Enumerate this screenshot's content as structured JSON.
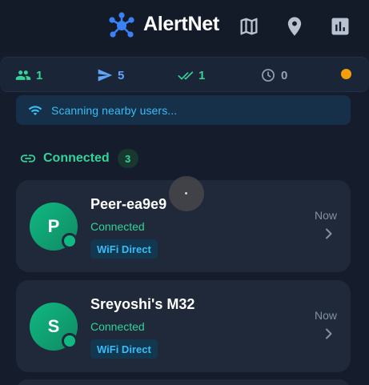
{
  "header": {
    "title": "AlertNet",
    "logo_icon": "network-hub-icon",
    "actions": [
      {
        "icon": "map-icon"
      },
      {
        "icon": "location-pin-icon"
      },
      {
        "icon": "bar-chart-icon"
      }
    ]
  },
  "stats": {
    "peers": {
      "icon": "people-icon",
      "value": "1",
      "color": "#34d399"
    },
    "sent": {
      "icon": "send-icon",
      "value": "5",
      "color": "#60a5fa"
    },
    "delivered": {
      "icon": "double-check-icon",
      "value": "1",
      "color": "#34d399"
    },
    "pending": {
      "icon": "clock-icon",
      "value": "0",
      "color": "#94a3b8"
    },
    "status_dot_color": "#f59e0b"
  },
  "scan": {
    "icon": "wifi-icon",
    "text": "Scanning nearby users..."
  },
  "section": {
    "icon": "link-icon",
    "title": "Connected",
    "count": "3"
  },
  "peers": [
    {
      "initial": "P",
      "name": "Peer-ea9e9",
      "status": "Connected",
      "connection": "WiFi Direct",
      "time": "Now"
    },
    {
      "initial": "S",
      "name": "Sreyoshi's M32",
      "status": "Connected",
      "connection": "WiFi Direct",
      "time": "Now"
    }
  ],
  "colors": {
    "accent_green": "#34d399",
    "accent_blue": "#38bdf8",
    "card_bg": "#1f2939",
    "page_bg": "#151d2c"
  }
}
